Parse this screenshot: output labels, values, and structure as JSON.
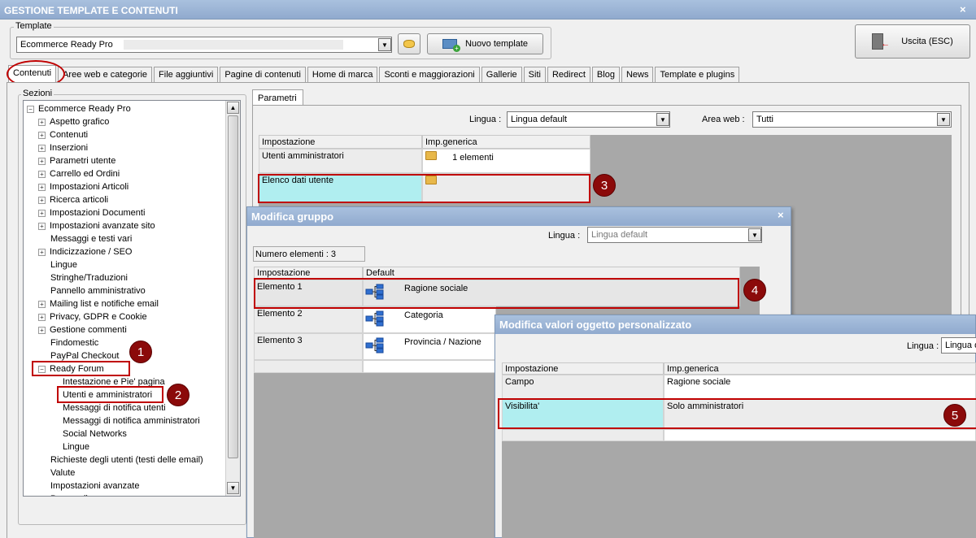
{
  "window": {
    "title": "GESTIONE TEMPLATE E CONTENUTI",
    "close": "×"
  },
  "template": {
    "legend": "Template",
    "selected": "Ecommerce Ready Pro",
    "new_button": "Nuovo template",
    "exit_button": "Uscita (ESC)"
  },
  "tabs": [
    "Contenuti",
    "Aree web e categorie",
    "File aggiuntivi",
    "Pagine di contenuti",
    "Home di marca",
    "Sconti e maggiorazioni",
    "Gallerie",
    "Siti",
    "Redirect",
    "Blog",
    "News",
    "Template e plugins"
  ],
  "sections": {
    "legend": "Sezioni",
    "root": "Ecommerce Ready Pro",
    "items": [
      {
        "label": "Aspetto grafico",
        "exp": "+"
      },
      {
        "label": "Contenuti",
        "exp": "+"
      },
      {
        "label": "Inserzioni",
        "exp": "+"
      },
      {
        "label": "Parametri utente",
        "exp": "+"
      },
      {
        "label": "Carrello ed Ordini",
        "exp": "+"
      },
      {
        "label": "Impostazioni Articoli",
        "exp": "+"
      },
      {
        "label": "Ricerca articoli",
        "exp": "+"
      },
      {
        "label": "Impostazioni Documenti",
        "exp": "+"
      },
      {
        "label": "Impostazioni avanzate sito",
        "exp": "+"
      },
      {
        "label": "Messaggi e testi vari",
        "exp": ""
      },
      {
        "label": "Indicizzazione / SEO",
        "exp": "+"
      },
      {
        "label": "Lingue",
        "exp": ""
      },
      {
        "label": "Stringhe/Traduzioni",
        "exp": ""
      },
      {
        "label": "Pannello amministrativo",
        "exp": ""
      },
      {
        "label": "Mailing list e notifiche email",
        "exp": "+"
      },
      {
        "label": "Privacy, GDPR e Cookie",
        "exp": "+"
      },
      {
        "label": "Gestione commenti",
        "exp": "+"
      },
      {
        "label": "Findomestic",
        "exp": ""
      },
      {
        "label": "PayPal Checkout",
        "exp": ""
      },
      {
        "label": "Ready Forum",
        "exp": "−"
      }
    ],
    "forum_children": [
      "Intestazione e Pie' pagina",
      "Utenti e amministratori",
      "Messaggi di notifica utenti",
      "Messaggi di notifica amministratori",
      "Social Networks",
      "Lingue"
    ],
    "after": [
      "Richieste degli utenti (testi delle email)",
      "Valute",
      "Impostazioni avanzate",
      "Personalizza..."
    ]
  },
  "params": {
    "tab": "Parametri",
    "lingua_label": "Lingua :",
    "lingua_value": "Lingua default",
    "area_label": "Area web :",
    "area_value": "Tutti",
    "col1": "Impostazione",
    "col2": "Imp.generica",
    "rows": [
      {
        "name": "Utenti amministratori",
        "value": "1 elementi"
      },
      {
        "name": "Elenco dati utente",
        "value": ""
      }
    ]
  },
  "gruppo": {
    "title": "Modifica gruppo",
    "lingua_label": "Lingua :",
    "lingua_value": "Lingua default",
    "count": "Numero elementi : 3",
    "col1": "Impostazione",
    "col2": "Default",
    "rows": [
      {
        "name": "Elemento 1",
        "value": "Ragione sociale"
      },
      {
        "name": "Elemento 2",
        "value": "Categoria"
      },
      {
        "name": "Elemento 3",
        "value": "Provincia / Nazione"
      }
    ]
  },
  "oggetto": {
    "title": "Modifica valori oggetto personalizzato",
    "lingua_label": "Lingua :",
    "lingua_value": "Lingua d",
    "col1": "Impostazione",
    "col2": "Imp.generica",
    "rows": [
      {
        "name": "Campo",
        "value": "Ragione sociale"
      },
      {
        "name": "Visibilita'",
        "value": "Solo amministratori"
      }
    ]
  },
  "badges": [
    "1",
    "2",
    "3",
    "4",
    "5"
  ],
  "colors": {
    "titlebar": "#9cb5d6",
    "highlight": "#b0eef0",
    "annotation": "#c00000",
    "badge": "#8b0a0a"
  }
}
